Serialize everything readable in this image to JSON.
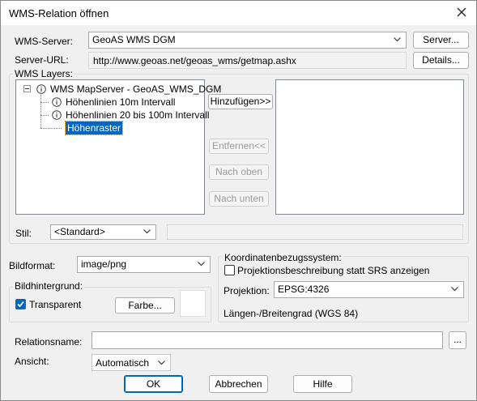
{
  "window": {
    "title": "WMS-Relation öffnen"
  },
  "server": {
    "label": "WMS-Server:",
    "value": "GeoAS WMS DGM",
    "button": "Server...",
    "url_label": "Server-URL:",
    "url_value": "http://www.geoas.net/geoas_wms/getmap.ashx",
    "details_button": "Details..."
  },
  "layers": {
    "group_label": "WMS Layers:",
    "tree": {
      "root": "WMS MapServer - GeoAS_WMS_DGM",
      "children": [
        "Höhenlinien 10m Intervall",
        "Höhenlinien 20 bis 100m Intervall",
        "Höhenraster"
      ]
    },
    "add_button": "Hinzufügen>>",
    "remove_button": "Entfernen<<",
    "up_button": "Nach oben",
    "down_button": "Nach unten",
    "style_label": "Stil:",
    "style_value": "<Standard>"
  },
  "image": {
    "format_label": "Bildformat:",
    "format_value": "image/png",
    "background_group": "Bildhintergrund:",
    "transparent_label": "Transparent",
    "transparent_checked": true,
    "color_button": "Farbe..."
  },
  "crs": {
    "group_label": "Koordinatenbezugssystem:",
    "checkbox_label": "Projektionsbeschreibung statt SRS anzeigen",
    "checkbox_checked": false,
    "projection_label": "Projektion:",
    "projection_value": "EPSG:4326",
    "description": "Längen-/Breitengrad (WGS 84)"
  },
  "relation": {
    "name_label": "Relationsname:",
    "name_value": "",
    "browse_button": "...",
    "view_label": "Ansicht:",
    "view_value": "Automatisch"
  },
  "footer": {
    "ok": "OK",
    "cancel": "Abbrechen",
    "help": "Hilfe"
  },
  "colors": {
    "accent": "#0067c0",
    "selection": "#0067c0"
  }
}
